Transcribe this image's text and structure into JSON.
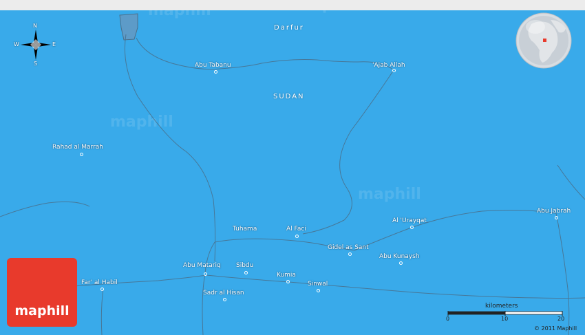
{
  "region_label": "Darfur",
  "country_label": "SUDAN",
  "places": [
    {
      "name": "Abu Tabanu"
    },
    {
      "name": "'Ajab Allah"
    },
    {
      "name": "Rahad al Marrah"
    },
    {
      "name": "Tuhama"
    },
    {
      "name": "Al Faci"
    },
    {
      "name": "Al 'Urayqat"
    },
    {
      "name": "Abu Jabrah"
    },
    {
      "name": "Gidel as Sant"
    },
    {
      "name": "Abu Kunaysh"
    },
    {
      "name": "Abu Matariq"
    },
    {
      "name": "Sibdu"
    },
    {
      "name": "Kumia"
    },
    {
      "name": "Sinwal"
    },
    {
      "name": "Sadr al Hisan"
    },
    {
      "name": "Far' al Habil"
    }
  ],
  "compass": {
    "n": "N",
    "s": "S",
    "e": "E",
    "w": "W"
  },
  "scale": {
    "unit": "kilometers",
    "ticks": [
      "0",
      "10",
      "20"
    ]
  },
  "logo_text": "maphill",
  "watermark": "maphill",
  "copyright": "© 2011 Maphill",
  "colors": {
    "water": "#39aaea",
    "logo": "#e83a2c",
    "route": "#4a6f8a"
  }
}
